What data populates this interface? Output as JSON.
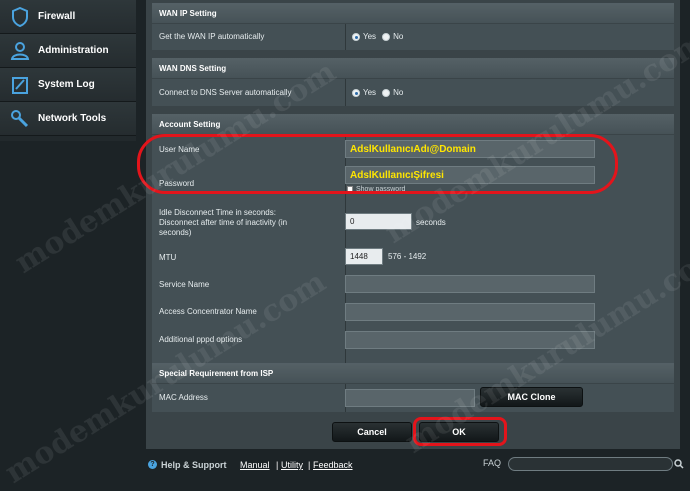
{
  "sidebar": {
    "items": [
      {
        "label": "Firewall",
        "icon": "shield-icon"
      },
      {
        "label": "Administration",
        "icon": "user-admin-icon"
      },
      {
        "label": "System Log",
        "icon": "log-icon"
      },
      {
        "label": "Network Tools",
        "icon": "tools-icon"
      }
    ]
  },
  "wan_ip": {
    "header": "WAN IP Setting",
    "label": "Get the WAN IP automatically",
    "yes": "Yes",
    "no": "No",
    "selected": "Yes"
  },
  "wan_dns": {
    "header": "WAN DNS Setting",
    "label": "Connect to DNS Server automatically",
    "yes": "Yes",
    "no": "No",
    "selected": "Yes"
  },
  "account": {
    "header": "Account Setting",
    "user_name_label": "User Name",
    "user_name_value": "AdslKullanıcıAdı@Domain",
    "password_label": "Password",
    "password_value": "AdslKullanıcıŞifresi",
    "show_password_label": "Show password",
    "idle_label": "Idle Disconnect Time in seconds: Disconnect after time of inactivity (in seconds)",
    "idle_value": "0",
    "idle_unit": "seconds",
    "mtu_label": "MTU",
    "mtu_value": "1448",
    "mtu_range": "576 - 1492",
    "service_name_label": "Service Name",
    "service_name_value": "",
    "ac_name_label": "Access Concentrator Name",
    "ac_name_value": "",
    "pppd_label": "Additional pppd options",
    "pppd_value": ""
  },
  "isp": {
    "header": "Special Requirement from ISP",
    "mac_label": "MAC Address",
    "mac_value": "",
    "mac_clone_button": "MAC Clone"
  },
  "actions": {
    "cancel": "Cancel",
    "ok": "OK"
  },
  "footer": {
    "help_support": "Help & Support",
    "manual": "Manual",
    "utility": "Utility",
    "feedback": "Feedback",
    "sep": "|",
    "faq": "FAQ",
    "search_placeholder": ""
  },
  "watermark": {
    "text": "modemkurulumu.com"
  },
  "colors": {
    "annotation": "#e3141b",
    "highlight_text": "#ffe600",
    "accent_link": "#4aa3df"
  }
}
